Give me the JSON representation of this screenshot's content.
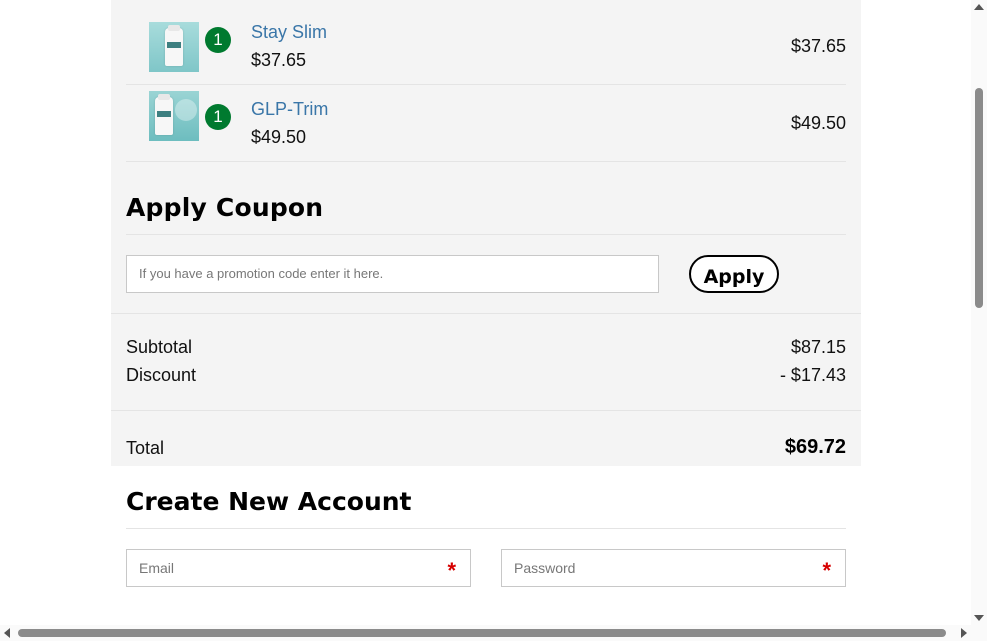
{
  "cart": {
    "items": [
      {
        "name": "Stay Slim",
        "qty": "1",
        "unit_price": "$37.65",
        "line_total": "$37.65",
        "thumb_icon": "product-bottle-image"
      },
      {
        "name": "GLP-Trim",
        "qty": "1",
        "unit_price": "$49.50",
        "line_total": "$49.50",
        "thumb_icon": "product-bottle-image"
      }
    ]
  },
  "coupon": {
    "title": "Apply Coupon",
    "placeholder": "If you have a promotion code enter it here.",
    "apply_label": "Apply"
  },
  "summary": {
    "subtotal_label": "Subtotal",
    "subtotal_value": "$87.15",
    "discount_label": "Discount",
    "discount_value": "- $17.43",
    "total_label": "Total",
    "total_value": "$69.72"
  },
  "account": {
    "title": "Create New Account",
    "email_placeholder": "Email",
    "password_placeholder": "Password",
    "required_mark": "*"
  },
  "colors": {
    "qty_badge": "#007a2f",
    "item_name": "#3a76a8",
    "required": "#d60000",
    "panel_bg": "#f4f4f4"
  }
}
